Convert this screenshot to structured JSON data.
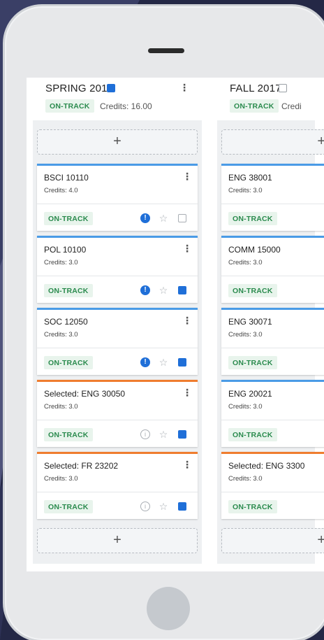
{
  "terms": [
    {
      "title": "SPRING 2017",
      "status": "ON-TRACK",
      "credits": "Credits: 16.00",
      "add_label": "+",
      "courses": [
        {
          "name": "BSCI 10110",
          "credits": "Credits: 4.0",
          "status": "ON-TRACK",
          "accent": "#4a9be6"
        },
        {
          "name": "POL 10100",
          "credits": "Credits: 3.0",
          "status": "ON-TRACK",
          "accent": "#4a9be6"
        },
        {
          "name": "SOC 12050",
          "credits": "Credits: 3.0",
          "status": "ON-TRACK",
          "accent": "#4a9be6"
        },
        {
          "name": "Selected: ENG 30050",
          "credits": "Credits: 3.0",
          "status": "ON-TRACK",
          "accent": "#ef7d2f"
        },
        {
          "name": "Selected: FR 23202",
          "credits": "Credits: 3.0",
          "status": "ON-TRACK",
          "accent": "#ef7d2f"
        }
      ]
    },
    {
      "title": "FALL 2017",
      "status": "ON-TRACK",
      "credits": "Credi",
      "add_label": "+",
      "courses": [
        {
          "name": "ENG 38001",
          "credits": "Credits: 3.0",
          "status": "ON-TRACK",
          "accent": "#4a9be6"
        },
        {
          "name": "COMM 15000",
          "credits": "Credits: 3.0",
          "status": "ON-TRACK",
          "accent": "#4a9be6"
        },
        {
          "name": "ENG 30071",
          "credits": "Credits: 3.0",
          "status": "ON-TRACK",
          "accent": "#4a9be6"
        },
        {
          "name": "ENG 20021",
          "credits": "Credits: 3.0",
          "status": "ON-TRACK",
          "accent": "#4a9be6"
        },
        {
          "name": "Selected: ENG 3300",
          "credits": "Credits: 3.0",
          "status": "ON-TRACK",
          "accent": "#ef7d2f"
        }
      ]
    }
  ],
  "icons": {
    "menu": "⋮",
    "alert": "!",
    "info": "i",
    "star": "☆"
  },
  "colors": {
    "blue_accent": "#4a9be6",
    "orange_accent": "#ef7d2f",
    "note_blue": "#1f6fd8",
    "badge_green": "#2b8b4e"
  }
}
